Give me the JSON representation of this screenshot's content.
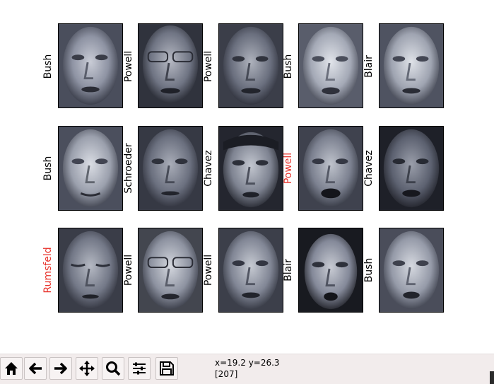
{
  "colors": {
    "correct_label": "#000000",
    "wrong_label": "#e8322b",
    "toolbar_bg": "#f2ecec"
  },
  "faces": [
    {
      "label": "Bush",
      "correct": true
    },
    {
      "label": "Powell",
      "correct": true
    },
    {
      "label": "Powell",
      "correct": true
    },
    {
      "label": "Bush",
      "correct": true
    },
    {
      "label": "Blair",
      "correct": true
    },
    {
      "label": "Bush",
      "correct": true
    },
    {
      "label": "Schroeder",
      "correct": true
    },
    {
      "label": "Chavez",
      "correct": true
    },
    {
      "label": "Powell",
      "correct": false
    },
    {
      "label": "Chavez",
      "correct": true
    },
    {
      "label": "Rumsfeld",
      "correct": false
    },
    {
      "label": "Powell",
      "correct": true
    },
    {
      "label": "Powell",
      "correct": true
    },
    {
      "label": "Blair",
      "correct": true
    },
    {
      "label": "Bush",
      "correct": true
    }
  ],
  "toolbar": {
    "buttons": [
      {
        "icon": "home-icon"
      },
      {
        "icon": "back-arrow-icon"
      },
      {
        "icon": "forward-arrow-icon"
      },
      {
        "icon": "pan-icon"
      },
      {
        "icon": "zoom-icon"
      },
      {
        "icon": "configure-subplots-icon"
      },
      {
        "icon": "save-icon"
      }
    ],
    "coords": "x=19.2 y=26.3",
    "pixel_value": "[207]"
  }
}
